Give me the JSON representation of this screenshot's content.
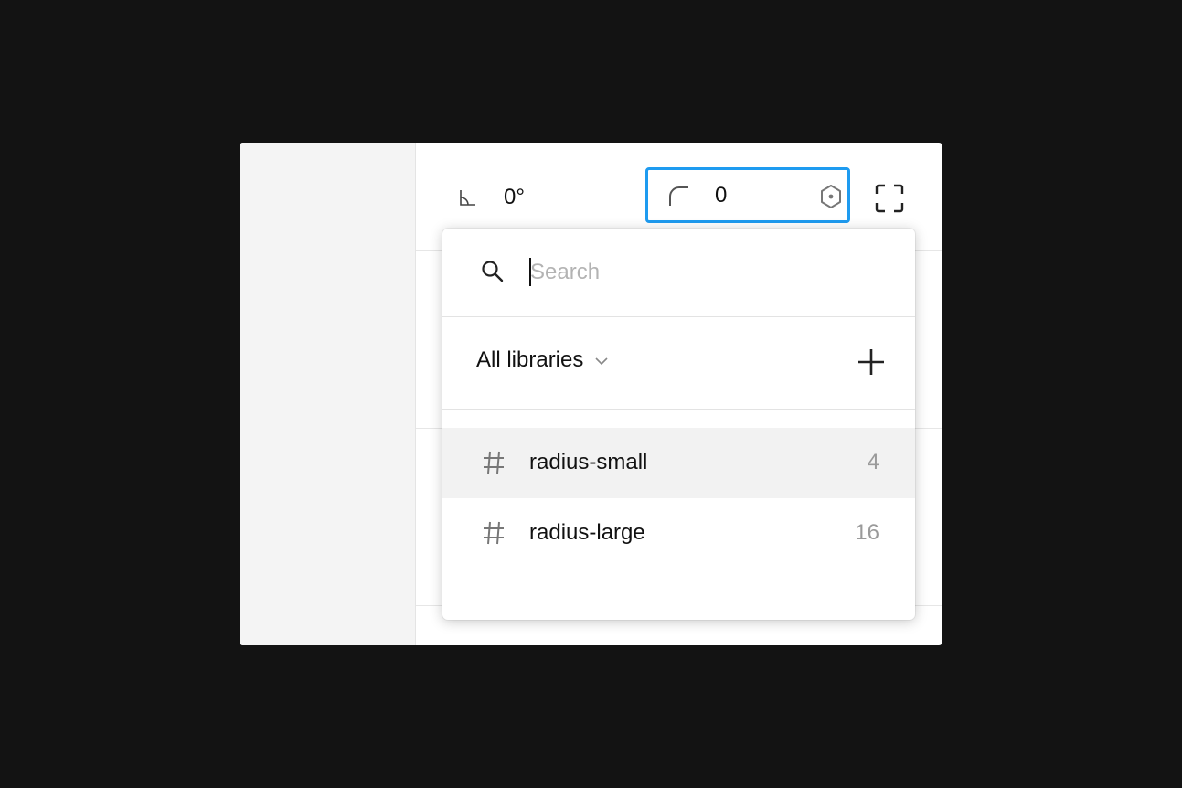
{
  "properties": {
    "rotation_value": "0°",
    "corner_radius_value": "0"
  },
  "popover": {
    "search": {
      "placeholder": "Search",
      "value": ""
    },
    "library_filter": {
      "selected": "All libraries"
    },
    "variables": [
      {
        "name": "radius-small",
        "value": "4",
        "icon": "hash-icon"
      },
      {
        "name": "radius-large",
        "value": "16",
        "icon": "hash-icon"
      }
    ]
  },
  "colors": {
    "backdrop": "#131313",
    "focus_ring": "#1e9bf0",
    "hover_row": "#f2f2f2",
    "muted_text": "#9a9a9a"
  }
}
